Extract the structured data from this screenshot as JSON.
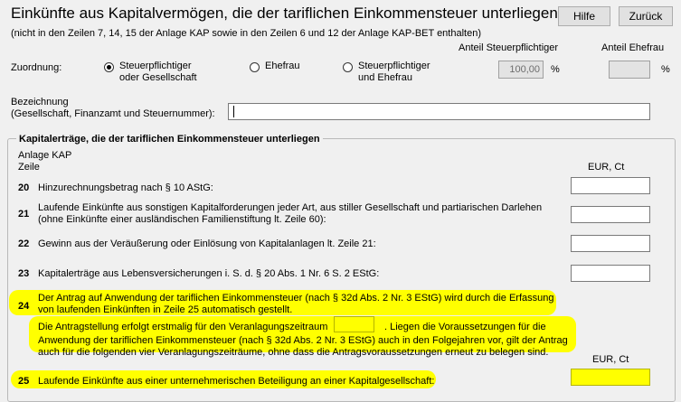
{
  "header": {
    "title": "Einkünfte aus Kapitalvermögen, die der tariflichen Einkommensteuer unterliegen",
    "subtitle": "(nicht in den Zeilen 7, 14, 15 der Anlage KAP sowie in den Zeilen 6 und 12 der Anlage KAP-BET enthalten)",
    "help_label": "Hilfe",
    "back_label": "Zurück"
  },
  "zuordnung": {
    "label": "Zuordnung:",
    "options": [
      {
        "line1": "Steuerpflichtiger",
        "line2": "oder Gesellschaft",
        "selected": true
      },
      {
        "line1": "Ehefrau",
        "line2": "",
        "selected": false
      },
      {
        "line1": "Steuerpflichtiger",
        "line2": "und Ehefrau",
        "selected": false
      }
    ],
    "anteil_stpfl_label": "Anteil Steuerpflichtiger",
    "anteil_stpfl_value": "100,00",
    "anteil_ehefrau_label": "Anteil Ehefrau",
    "anteil_ehefrau_value": "",
    "percent": "%"
  },
  "bezeichnung": {
    "line1": "Bezeichnung",
    "line2": "(Gesellschaft, Finanzamt und Steuernummer):",
    "value": ""
  },
  "group": {
    "title": "Kapitalerträge, die der tariflichen Einkommensteuer unterliegen",
    "col_header_1": "Anlage KAP",
    "col_header_2": "Zeile",
    "eur_label": "EUR, Ct",
    "rows": {
      "r20": {
        "nr": "20",
        "text": "Hinzurechnungsbetrag nach § 10 AStG:"
      },
      "r21": {
        "nr": "21",
        "text1": "Laufende Einkünfte aus sonstigen Kapitalforderungen jeder Art, aus stiller Gesellschaft und partiarischen Darlehen",
        "text2": "(ohne Einkünfte einer ausländischen Familienstiftung lt. Zeile 60):"
      },
      "r22": {
        "nr": "22",
        "text": "Gewinn aus der Veräußerung oder Einlösung von Kapitalanlagen lt. Zeile 21:"
      },
      "r23": {
        "nr": "23",
        "text": "Kapitalerträge aus Lebensversicherungen i. S. d. § 20 Abs. 1 Nr. 6 S. 2 EStG:"
      },
      "r24": {
        "nr": "24",
        "text1": "Der Antrag auf Anwendung der tariflichen Einkommensteuer (nach § 32d Abs. 2 Nr. 3 EStG) wird durch die Erfassung",
        "text2": "von laufenden Einkünften in Zeile 25 automatisch gestellt.",
        "text3a": "Die Antragstellung erfolgt erstmalig für den Veranlagungszeitraum",
        "text3b": ". Liegen die Voraussetzungen für die",
        "text4": "Anwendung der tariflichen Einkommensteuer (nach § 32d Abs. 2 Nr. 3 EStG) auch in den Folgejahren vor, gilt der Antrag",
        "text5": "auch für die folgenden vier Veranlagungszeiträume, ohne dass die Antragsvoraussetzungen erneut zu belegen sind."
      },
      "r25": {
        "nr": "25",
        "text": "Laufende Einkünfte aus einer unternehmerischen Beteiligung an einer Kapitalgesellschaft:"
      }
    }
  },
  "colors": {
    "highlight": "#ffff00",
    "background": "#f0f0f0"
  }
}
